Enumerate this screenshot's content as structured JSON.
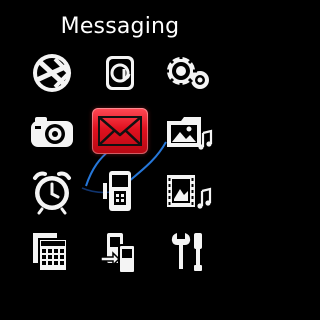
{
  "screen": {
    "title": "Messaging",
    "selected_index": 4,
    "colors": {
      "background": "#000000",
      "icon": "#f2f2f2",
      "selected_tile": "#e0111f",
      "accent_swoosh": "#3aa0ff"
    }
  },
  "menu": {
    "items": [
      {
        "icon": "internet-globe-icon"
      },
      {
        "icon": "at-sign-icon"
      },
      {
        "icon": "gears-icon"
      },
      {
        "icon": "camera-icon"
      },
      {
        "icon": "envelope-icon"
      },
      {
        "icon": "folder-gallery-icon"
      },
      {
        "icon": "alarm-clock-icon"
      },
      {
        "icon": "phone-device-icon"
      },
      {
        "icon": "film-music-icon"
      },
      {
        "icon": "calendar-pages-icon"
      },
      {
        "icon": "phone-transfer-icon"
      },
      {
        "icon": "tools-icon"
      }
    ]
  }
}
